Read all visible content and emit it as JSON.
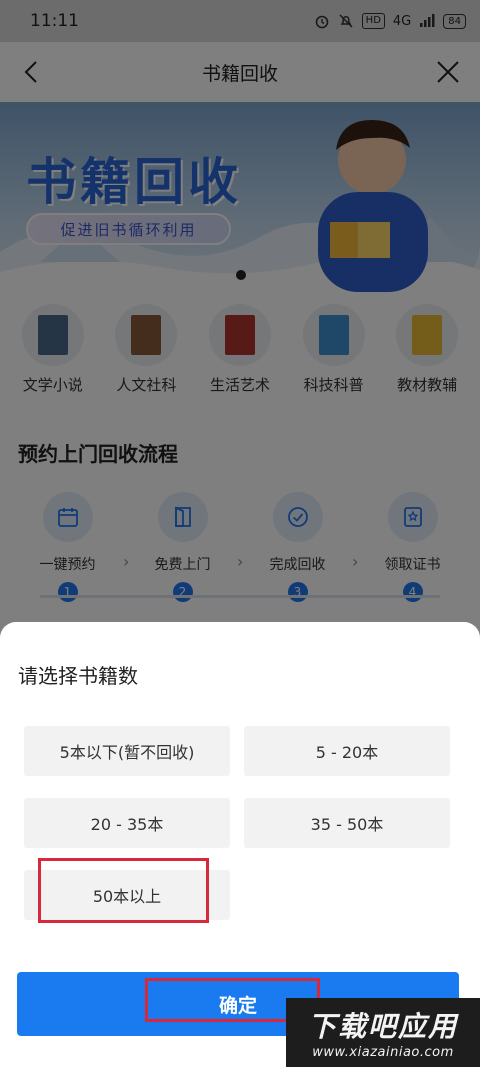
{
  "status_bar": {
    "time": "11:11",
    "network": "4G",
    "hd": "HD",
    "battery": "84"
  },
  "nav": {
    "title": "书籍回收"
  },
  "banner": {
    "title": "书籍回收",
    "subtitle": "促进旧书循环利用"
  },
  "categories": [
    {
      "label": "文学小说"
    },
    {
      "label": "人文社科"
    },
    {
      "label": "生活艺术"
    },
    {
      "label": "科技科普"
    },
    {
      "label": "教材教辅"
    }
  ],
  "process": {
    "title": "预约上门回收流程",
    "steps": [
      {
        "label": "一键预约",
        "num": "1"
      },
      {
        "label": "免费上门",
        "num": "2"
      },
      {
        "label": "完成回收",
        "num": "3"
      },
      {
        "label": "领取证书",
        "num": "4"
      }
    ]
  },
  "sheet": {
    "title": "请选择书籍数",
    "options": [
      "5本以下(暂不回收)",
      "5 - 20本",
      "20 - 35本",
      "35 - 50本",
      "50本以上"
    ],
    "confirm_label": "确定"
  },
  "watermark": {
    "main": "下载吧应用",
    "url": "www.xiazainiao.com"
  },
  "colors": {
    "accent": "#1a7bf0",
    "highlight": "#d8283b"
  }
}
